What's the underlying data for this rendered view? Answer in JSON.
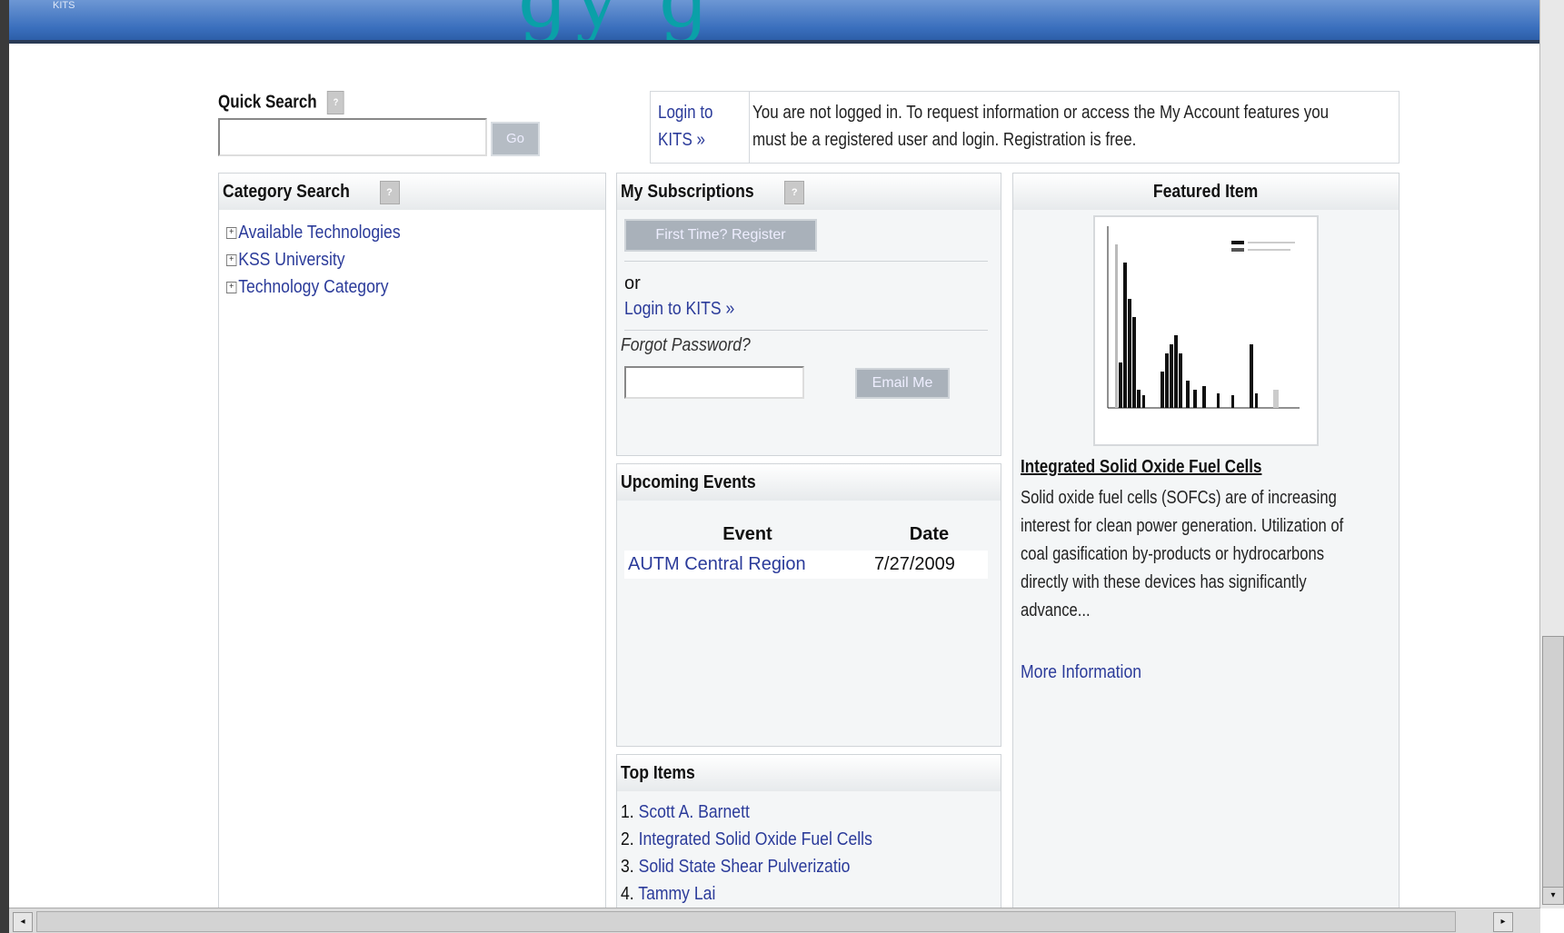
{
  "banner": {
    "text": "gy  g",
    "logo": "KITS"
  },
  "quick_search": {
    "label": "Quick Search",
    "go": "Go",
    "help": "?"
  },
  "login_notice": {
    "link": "Login to KITS »",
    "message": "You are not logged in. To request information or access the My Account features you must be a registered user and login. Registration is free."
  },
  "category_search": {
    "title": "Category Search",
    "help": "?",
    "items": [
      {
        "label": "Available Technologies"
      },
      {
        "label": "KSS University"
      },
      {
        "label": "Technology Category"
      }
    ]
  },
  "subscriptions": {
    "title": "My Subscriptions",
    "help": "?",
    "register_button": "First Time? Register",
    "or": "or",
    "login_link": "Login to KITS »",
    "forgot": "Forgot Password?",
    "email_button": "Email Me"
  },
  "events": {
    "title": "Upcoming Events",
    "col_event": "Event",
    "col_date": "Date",
    "rows": [
      {
        "event": "AUTM Central Region",
        "date": "7/27/2009"
      }
    ]
  },
  "top_items": {
    "title": "Top Items",
    "items": [
      {
        "num": "1.",
        "label": "Scott A. Barnett"
      },
      {
        "num": "2.",
        "label": "Integrated Solid Oxide Fuel Cells"
      },
      {
        "num": "3.",
        "label": "Solid State Shear Pulverizatio"
      },
      {
        "num": "4.",
        "label": "Tammy Lai"
      }
    ]
  },
  "featured": {
    "title": "Featured Item",
    "item_title": "Integrated Solid Oxide Fuel Cells",
    "description": "Solid oxide fuel cells (SOFCs) are of increasing interest for clean power generation. Utilization of coal gasification by-products or hydrocarbons directly with these devices has significantly advance...",
    "more": "More Information"
  },
  "colors": {
    "link": "#2b3b9a",
    "banner": "#3a6fbd",
    "banner_text": "#0aa0a8"
  }
}
